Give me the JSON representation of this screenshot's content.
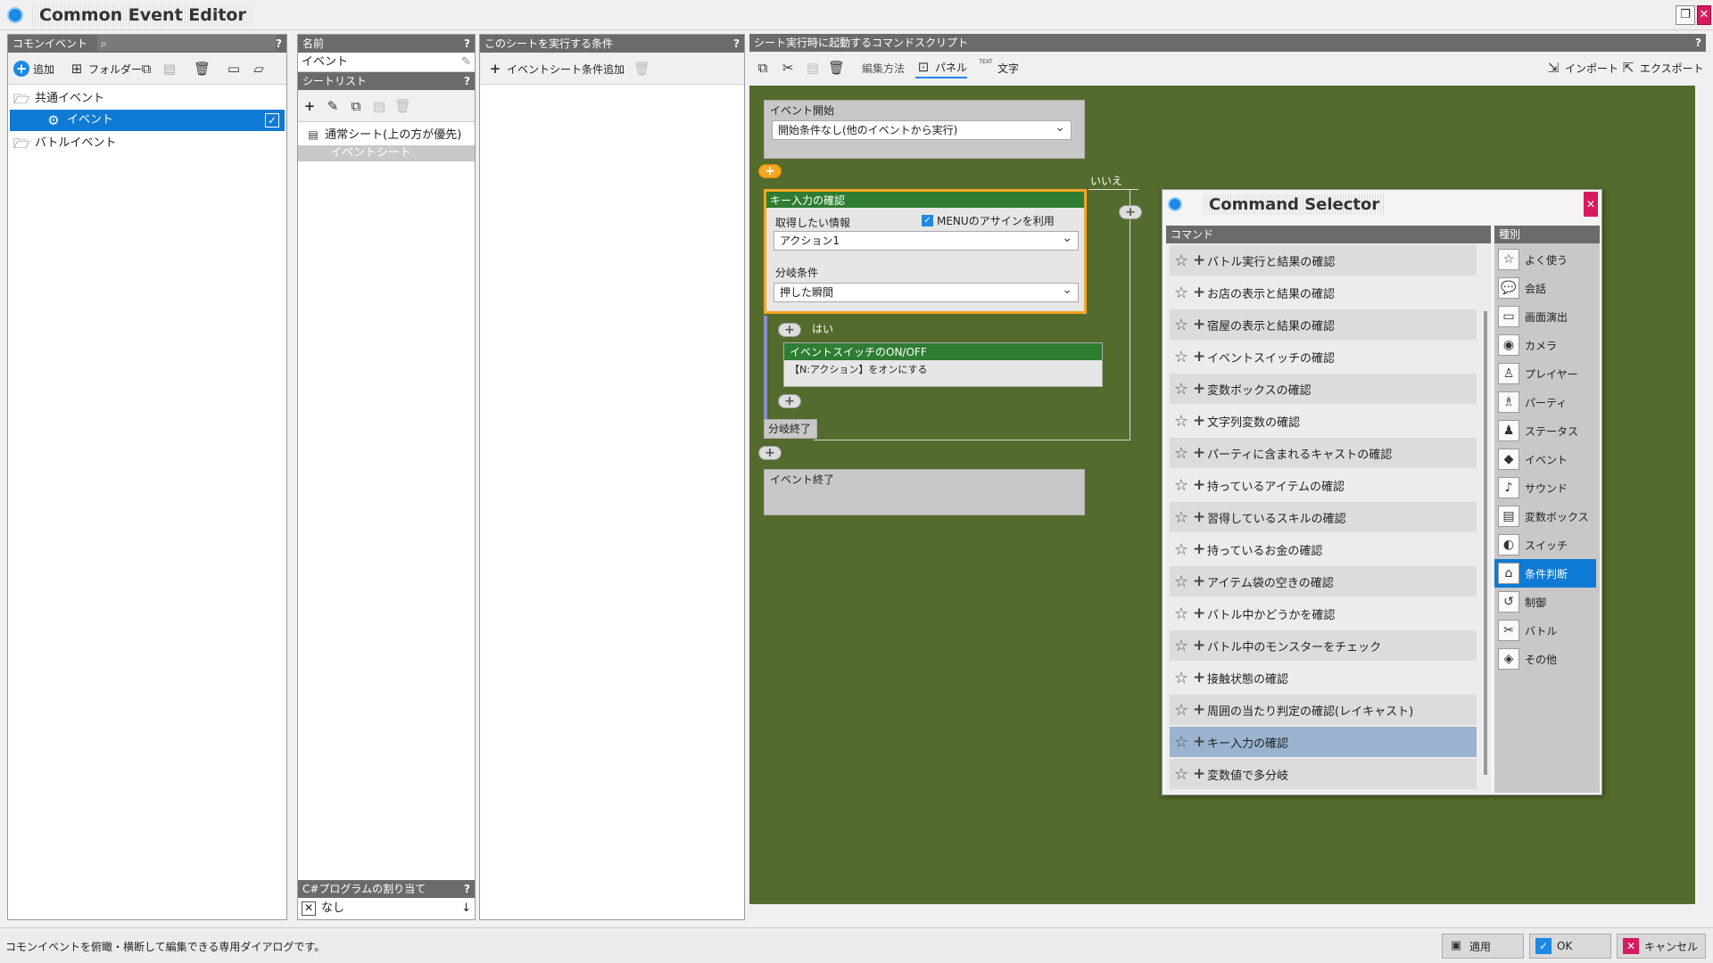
{
  "window": {
    "title": "Common Event Editor",
    "restore_icon": "restore-icon",
    "close_icon": "close-icon"
  },
  "left_panel": {
    "header": "コモンイベント",
    "help": "?",
    "toolbar": {
      "add_label": "追加",
      "folder_label": "フォルダー"
    },
    "tree": [
      {
        "label": "共通イベント",
        "type": "folder-open"
      },
      {
        "label": "イベント",
        "type": "event",
        "selected": true
      },
      {
        "label": "バトルイベント",
        "type": "folder-open"
      }
    ]
  },
  "name_panel": {
    "header": "名前",
    "help": "?",
    "value": "イベント",
    "sheetlist_header": "シートリスト",
    "sheets": [
      {
        "label": "通常シート(上の方が優先)"
      },
      {
        "label": "イベントシート",
        "selected": true
      }
    ],
    "csharp_header": "C#プログラムの割り当て",
    "csharp_value": "なし"
  },
  "conditions_panel": {
    "header": "このシートを実行する条件",
    "help": "?",
    "add_label": "イベントシート条件追加"
  },
  "script_panel": {
    "header": "シート実行時に起動するコマンドスクリプト",
    "help": "?",
    "edit_mode_label": "編集方法",
    "panel_label": "パネル",
    "text_label": "文字",
    "text_icon_label": "TEXT",
    "import_label": "インポート",
    "export_label": "エクスポート"
  },
  "flow": {
    "start": {
      "title": "イベント開始",
      "value": "開始条件なし(他のイベントから実行)"
    },
    "key_check": {
      "title": "キー入力の確認",
      "info_label": "取得したい情報",
      "menu_checkbox_label": "MENUのアサインを利用",
      "info_value": "アクション1",
      "branch_label": "分岐条件",
      "branch_value": "押した瞬間"
    },
    "no_label": "いいえ",
    "yes_label": "はい",
    "switch_node": {
      "title": "イベントスイッチのON/OFF",
      "body": "【N:アクション】をオンにする"
    },
    "branch_end": "分岐終了",
    "end": "イベント終了"
  },
  "command_selector": {
    "title": "Command Selector",
    "commands_header": "コマンド",
    "categories_header": "種別",
    "commands": [
      "バトル実行と結果の確認",
      "お店の表示と結果の確認",
      "宿屋の表示と結果の確認",
      "イベントスイッチの確認",
      "変数ボックスの確認",
      "文字列変数の確認",
      "パーティに含まれるキャストの確認",
      "持っているアイテムの確認",
      "習得しているスキルの確認",
      "持っているお金の確認",
      "アイテム袋の空きの確認",
      "バトル中かどうかを確認",
      "バトル中のモンスターをチェック",
      "接触状態の確認",
      "周囲の当たり判定の確認(レイキャスト)",
      "キー入力の確認",
      "変数値で多分岐"
    ],
    "selected_command": 15,
    "categories": [
      {
        "label": "よく使う",
        "icon": "star-icon"
      },
      {
        "label": "会話",
        "icon": "speech-bubble-icon"
      },
      {
        "label": "画面演出",
        "icon": "monitor-icon"
      },
      {
        "label": "カメラ",
        "icon": "camera-icon"
      },
      {
        "label": "プレイヤー",
        "icon": "player-icon"
      },
      {
        "label": "パーティ",
        "icon": "party-icon"
      },
      {
        "label": "ステータス",
        "icon": "status-icon"
      },
      {
        "label": "イベント",
        "icon": "event-icon"
      },
      {
        "label": "サウンド",
        "icon": "music-note-icon"
      },
      {
        "label": "変数ボックス",
        "icon": "variable-box-icon"
      },
      {
        "label": "スイッチ",
        "icon": "switch-icon"
      },
      {
        "label": "条件判断",
        "icon": "condition-icon"
      },
      {
        "label": "制御",
        "icon": "control-icon"
      },
      {
        "label": "バトル",
        "icon": "battle-icon"
      },
      {
        "label": "その他",
        "icon": "other-icon"
      }
    ],
    "selected_category": 11
  },
  "status_bar": {
    "message": "コモンイベントを俯瞰・横断して編集できる専用ダイアログです。",
    "apply_label": "適用",
    "ok_label": "OK",
    "cancel_label": "キャンセル"
  },
  "colors": {
    "accent": "#0e7ad3",
    "canvas": "#536b2c",
    "node_header_green": "#2e7d32",
    "highlight_orange": "#f5a623"
  }
}
